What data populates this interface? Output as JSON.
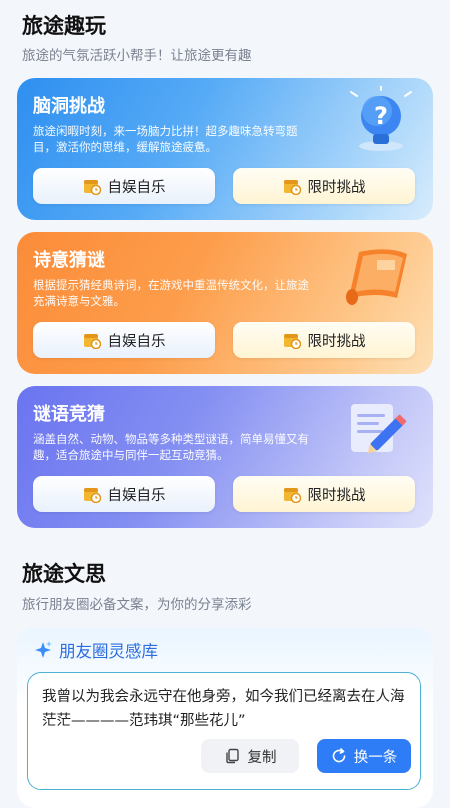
{
  "fun": {
    "title": "旅途趣玩",
    "subtitle": "旅途的气氛活跃小帮手！让旅途更有趣"
  },
  "cards": [
    {
      "title": "脑洞挑战",
      "desc": "旅途闲暇时刻，来一场脑力比拼！超多趣味急转弯题目，激活你的思维，缓解旅途疲惫。",
      "icon": "lightbulb-question-icon",
      "btn_left": "自娱自乐",
      "btn_right": "限时挑战"
    },
    {
      "title": "诗意猜谜",
      "desc": "根据提示猜经典诗词，在游戏中重温传统文化，让旅途充满诗意与文雅。",
      "icon": "scroll-icon",
      "btn_left": "自娱自乐",
      "btn_right": "限时挑战"
    },
    {
      "title": "谜语竞猜",
      "desc": "涵盖自然、动物、物品等多种类型谜语，简单易懂又有趣，适合旅途中与同伴一起互动竞猜。",
      "icon": "notepad-pencil-icon",
      "btn_left": "自娱自乐",
      "btn_right": "限时挑战"
    }
  ],
  "musings": {
    "title": "旅途文思",
    "subtitle": "旅行朋友圈必备文案，为你的分享添彩",
    "library_title": "朋友圈灵感库",
    "quote": "我曾以为我会永远守在他身旁，如今我们已经离去在人海茫茫————范玮琪“那些花儿”",
    "copy_label": "复制",
    "swap_label": "换一条"
  },
  "colors": {
    "blue_card": "#2e8ff0",
    "orange_card": "#fb8c39",
    "purple_card": "#6a74f0",
    "accent": "#2e7df6"
  }
}
